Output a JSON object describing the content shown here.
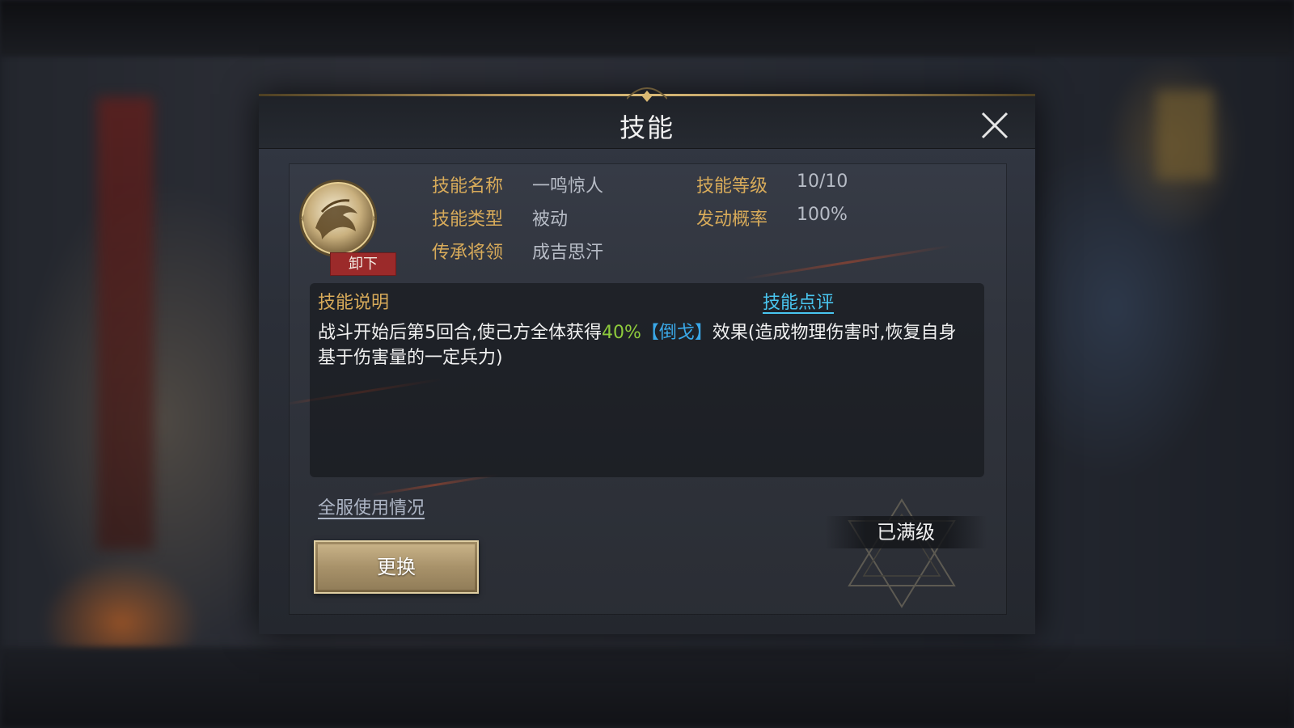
{
  "dialog": {
    "title": "技能",
    "close_icon": "close-icon"
  },
  "skill": {
    "icon": "dragon-emblem-icon",
    "unequip_label": "卸下",
    "fields": {
      "name_label": "技能名称",
      "name_value": "一鸣惊人",
      "level_label": "技能等级",
      "level_value": "10/10",
      "type_label": "技能类型",
      "type_value": "被动",
      "chance_label": "发动概率",
      "chance_value": "100%",
      "heir_label": "传承将领",
      "heir_value": "成吉思汗"
    }
  },
  "description": {
    "title": "技能说明",
    "review_link": "技能点评",
    "text_part1": "战斗开始后第5回合,使己方全体获得",
    "text_percent": "40%",
    "text_effect": "【倒戈】",
    "text_part2": "效果(造成物理伤害时,恢复自身基于伤害量的一定兵力)"
  },
  "footer": {
    "usage_link": "全服使用情况",
    "replace_button": "更换",
    "maxed_label": "已满级"
  },
  "colors": {
    "label_gold": "#d8ab5a",
    "value_gray": "#b7bcc6",
    "link_blue": "#49c6f0",
    "highlight_green": "#8ecb3c",
    "highlight_blue": "#3aa8e8",
    "unequip_red": "#9b2a2a"
  }
}
